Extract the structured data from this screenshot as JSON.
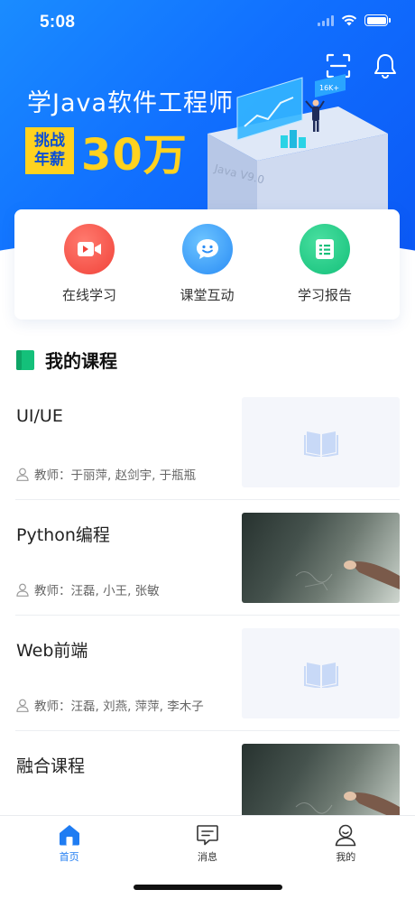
{
  "status_bar": {
    "time": "5:08"
  },
  "hero": {
    "title": "学Java软件工程师",
    "challenge_line1": "挑战",
    "challenge_line2": "年薪",
    "challenge_amount": "30万",
    "illustration_badge": "16K+",
    "illustration_label": "Java V9.0"
  },
  "quick_actions": [
    {
      "label": "在线学习",
      "icon": "video-icon",
      "color": "#f1433a"
    },
    {
      "label": "课堂互动",
      "icon": "chat-smile-icon",
      "color": "#2a8cf5"
    },
    {
      "label": "学习报告",
      "icon": "report-icon",
      "color": "#14c07a"
    }
  ],
  "section": {
    "title": "我的课程"
  },
  "courses": [
    {
      "name": "UI/UE",
      "teacher": "教师：于丽萍, 赵剑宇, 于瓶瓶",
      "thumb": "placeholder"
    },
    {
      "name": "Python编程",
      "teacher": "教师：汪磊, 小王, 张敏",
      "thumb": "photo"
    },
    {
      "name": "Web前端",
      "teacher": "教师：汪磊, 刘燕, 萍萍, 李木子",
      "thumb": "placeholder"
    },
    {
      "name": "融合课程",
      "teacher": "",
      "thumb": "photo"
    }
  ],
  "tabbar": {
    "items": [
      {
        "label": "首页",
        "icon": "home-icon",
        "active": true
      },
      {
        "label": "消息",
        "icon": "message-icon",
        "active": false
      },
      {
        "label": "我的",
        "icon": "profile-icon",
        "active": false
      }
    ]
  },
  "colors": {
    "accent": "#1f7cf2",
    "hero_yellow": "#ffd21f"
  }
}
